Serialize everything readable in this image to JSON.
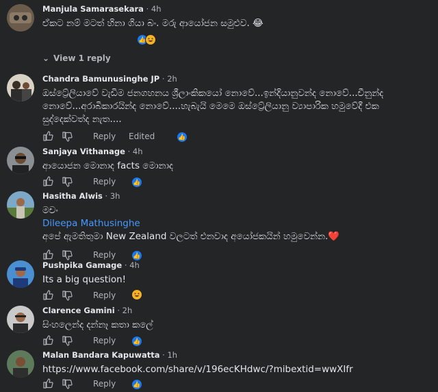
{
  "comments": [
    {
      "author": "Manjula Samarasekara",
      "time": "4h",
      "text": "ඒකට නම් මටත් හිනා ගියා බං. මරු ආයෝජන සමුළුව. 😂",
      "reply_label": "",
      "reactions": [
        "like",
        "haha"
      ]
    },
    {
      "author": "Chandra Bamunusinghe JP",
      "time": "2h",
      "text": "ඔස්ට්‍රේලියාවේ වැඩිම ජනගහනය ශ්‍රීලාංකිකයෝ නොවේ...ඉන්දියානුවන්ද නොවේ...චීනුන්ද නොවේ...අරාබිකාරයින්ද නොවේ....හැබැයි මෙමෙ ඔස්ට්‍රේලියානු ව්‍යාපාරික හමුවේදී එක සුද්දෙක්වත්ද නැත....",
      "reply_label": "Reply",
      "edited_label": "Edited",
      "reactions": [
        "like"
      ]
    },
    {
      "author": "Sanjaya Vithanage",
      "time": "4h",
      "text": "ආයොජන මොනාද facts මොනාද",
      "reply_label": "Reply",
      "reactions": [
        "like"
      ]
    },
    {
      "author": "Hasitha Alwis",
      "time": "3h",
      "text": "මචං",
      "tag": "Dileepa Mathusinghe",
      "text2": "අපේ ඇමතිතුමා New Zealand වලටත් එනවාද අයෝජකයින් හමුවෙන්න.❤️",
      "reply_label": "Reply",
      "reactions": [
        "like"
      ]
    },
    {
      "author": "Pushpika Gamage",
      "time": "4h",
      "text": "Its a big question!",
      "reply_label": "Reply",
      "reactions": [
        "haha"
      ]
    },
    {
      "author": "Clarence Gamini",
      "time": "2h",
      "text": "සිංහලෙන්ද දන්නෑ කතා කලේ",
      "reply_label": "Reply",
      "reactions": [
        "like"
      ]
    },
    {
      "author": "Malan Bandara Kapuwatta",
      "time": "1h",
      "text": "https://www.facebook.com/share/v/196ecKHdwc/?mibextid=wwXIfr",
      "reply_label": "Reply",
      "reactions": [
        "like"
      ]
    }
  ],
  "view_replies": "View 1 reply",
  "meta_sep": "·",
  "icons": {
    "like": "thumbs-up-icon",
    "dislike": "thumbs-down-icon",
    "haha": "haha-emoji-icon"
  },
  "colors": {
    "background": "#242526",
    "text": "#e4e6eb",
    "muted": "#b0b3b8",
    "link": "#4599ff",
    "like": "#1877f2"
  }
}
